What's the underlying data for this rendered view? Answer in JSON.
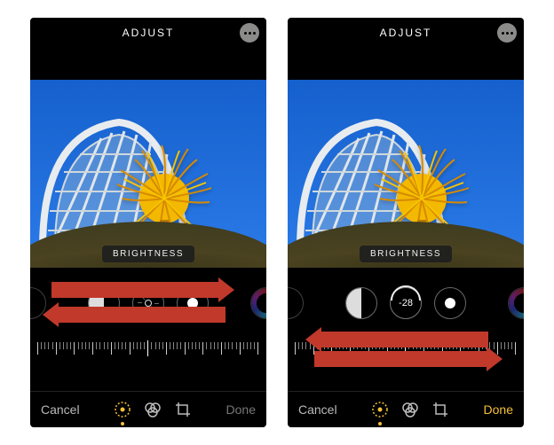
{
  "header": {
    "title": "ADJUST"
  },
  "overlay": {
    "label": "BRIGHTNESS"
  },
  "bottom": {
    "cancel": "Cancel",
    "done": "Done"
  },
  "left_phone": {
    "slider_center_position": 0.5,
    "selected_dial": "brightness",
    "value_display": null,
    "done_active": false
  },
  "right_phone": {
    "value_display": "-28",
    "slider_center_position": 0.5,
    "indicator_offset": 0.6,
    "done_active": true
  },
  "dials": {
    "items": [
      "exposure",
      "contrast",
      "brightness",
      "black-point",
      "color"
    ]
  },
  "tools": {
    "items": [
      "adjust",
      "filters",
      "crop"
    ],
    "selected": "adjust"
  }
}
